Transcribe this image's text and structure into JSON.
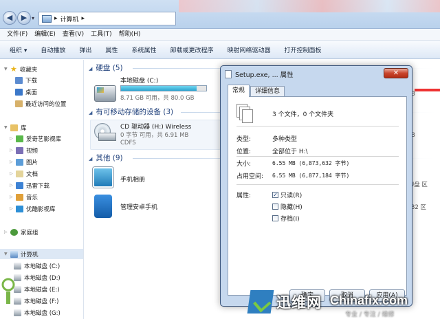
{
  "address": {
    "root_sep": "▸",
    "location": "计算机",
    "sep": "▸"
  },
  "menu": [
    "文件(F)",
    "编辑(E)",
    "查看(V)",
    "工具(T)",
    "帮助(H)"
  ],
  "toolbar": [
    "组织 ▾",
    "自动播放",
    "弹出",
    "属性",
    "系统属性",
    "卸载或更改程序",
    "映射网络驱动器",
    "打开控制面板"
  ],
  "nav": {
    "favorites": {
      "label": "收藏夹",
      "items": [
        "下载",
        "桌面",
        "最近访问的位置"
      ]
    },
    "libraries": {
      "label": "库",
      "items": [
        "爱奇艺影视库",
        "视频",
        "图片",
        "文档",
        "迅雷下载",
        "音乐",
        "优酷影视库"
      ]
    },
    "homegroup": "家庭组",
    "computer": {
      "label": "计算机",
      "items": [
        "本地磁盘 (C:)",
        "本地磁盘 (D:)",
        "本地磁盘 (E:)",
        "本地磁盘 (F:)",
        "本地磁盘 (G:)"
      ]
    }
  },
  "content": {
    "hdd_group": "硬盘 (5)",
    "drive_c": {
      "name": "本地磁盘 (C:)",
      "sub": "8.71 GB 可用，共 80.0 GB",
      "used_fraction": 0.89
    },
    "removable_group": "有可移动存储的设备 (3)",
    "drive_h": {
      "name": "CD 驱动器 (H:) Wireless",
      "sub1": "0 字节 可用，共 6.91 MB",
      "sub2": "CDFS"
    },
    "other_group": "其他 (9)",
    "others": [
      "手机相册",
      "管理安卓手机"
    ],
    "right_bits": [
      "B",
      "B",
      "U盘 区",
      "32 区"
    ]
  },
  "dialog": {
    "title": "Setup.exe, ... 属性",
    "close": "✕",
    "tabs": [
      "常规",
      "详细信息"
    ],
    "count": "3 个文件，0 个文件夹",
    "type_label": "类型:",
    "type_value": "多种类型",
    "loc_label": "位置:",
    "loc_value": "全部位于 H:\\",
    "size_label": "大小:",
    "size_value": "6.55 MB (6,873,632 字节)",
    "disk_label": "占用空间:",
    "disk_value": "6.55 MB (6,877,184 字节)",
    "attr_label": "属性:",
    "attrs": [
      {
        "label": "只读(R)",
        "checked": "✓"
      },
      {
        "label": "隐藏(H)",
        "checked": ""
      },
      {
        "label": "存档(I)",
        "checked": ""
      }
    ],
    "buttons": [
      "确定",
      "取消",
      "应用(A)"
    ]
  },
  "watermark": {
    "cn": "迅维网",
    "en": "Chinafix.com",
    "sub": "专业 / 专注 / 维修"
  }
}
